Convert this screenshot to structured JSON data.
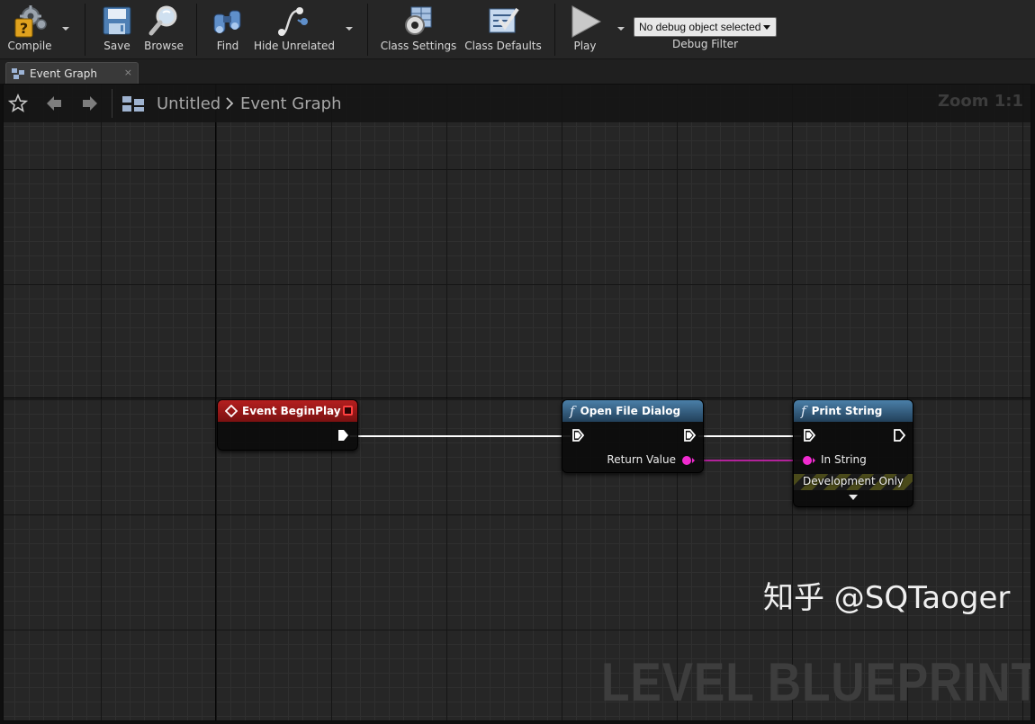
{
  "toolbar": {
    "compile_label": "Compile",
    "save_label": "Save",
    "browse_label": "Browse",
    "find_label": "Find",
    "hide_unrelated_label": "Hide Unrelated",
    "class_settings_label": "Class Settings",
    "class_defaults_label": "Class Defaults",
    "play_label": "Play",
    "debug_filter": {
      "selected": "No debug object selected",
      "label": "Debug Filter"
    }
  },
  "tab": {
    "label": "Event Graph",
    "close": "×"
  },
  "breadcrumb": {
    "root": "Untitled",
    "current": "Event Graph"
  },
  "graph": {
    "zoom": "Zoom 1:1",
    "watermark": "LEVEL BLUEPRINT",
    "nodes": {
      "event_begin_play": {
        "title": "Event BeginPlay"
      },
      "open_file_dialog": {
        "title": "Open File Dialog",
        "return_value": "Return Value"
      },
      "print_string": {
        "title": "Print String",
        "in_string": "In String",
        "dev_only": "Development Only"
      }
    }
  },
  "overlay": {
    "credit": "知乎 @SQTaoger"
  },
  "colors": {
    "event_header": "#b41f1f",
    "function_header": "#4a7fa8",
    "string_pin": "#f12bd0",
    "exec_wire": "#ffffff"
  }
}
